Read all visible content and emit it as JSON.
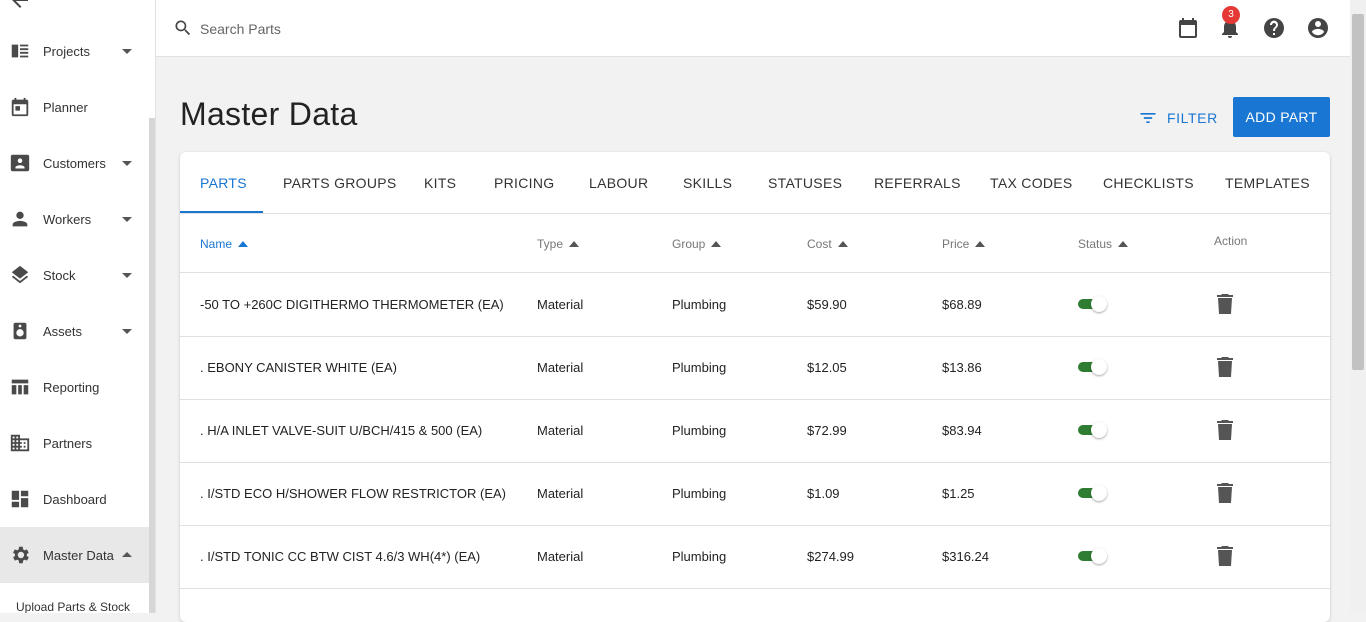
{
  "colors": {
    "accent": "#1976d2",
    "toggle_on": "#2e7d32",
    "badge": "#e53935"
  },
  "sidebar": {
    "items": [
      {
        "label": "Projects",
        "icon": "projects-icon",
        "has_caret": true
      },
      {
        "label": "Planner",
        "icon": "calendar-icon",
        "has_caret": false
      },
      {
        "label": "Customers",
        "icon": "contact-card-icon",
        "has_caret": true
      },
      {
        "label": "Workers",
        "icon": "person-icon",
        "has_caret": true
      },
      {
        "label": "Stock",
        "icon": "layers-icon",
        "has_caret": true
      },
      {
        "label": "Assets",
        "icon": "assets-icon",
        "has_caret": true
      },
      {
        "label": "Reporting",
        "icon": "table-icon",
        "has_caret": false
      },
      {
        "label": "Partners",
        "icon": "building-icon",
        "has_caret": false
      },
      {
        "label": "Dashboard",
        "icon": "dashboard-icon",
        "has_caret": false
      },
      {
        "label": "Master Data",
        "icon": "gear-icon",
        "has_caret": true,
        "expanded": true,
        "active": true
      }
    ],
    "subitem": "Upload Parts & Stock"
  },
  "topbar": {
    "search_placeholder": "Search Parts",
    "notification_count": "3"
  },
  "page": {
    "title": "Master Data",
    "filter_label": "FILTER",
    "add_label": "ADD PART"
  },
  "tabs": [
    "PARTS",
    "PARTS GROUPS",
    "KITS",
    "PRICING",
    "LABOUR",
    "SKILLS",
    "STATUSES",
    "REFERRALS",
    "TAX CODES",
    "CHECKLISTS",
    "TEMPLATES"
  ],
  "active_tab": "PARTS",
  "table": {
    "columns": [
      "Name",
      "Type",
      "Group",
      "Cost",
      "Price",
      "Status",
      "Action"
    ],
    "sorted_column": "Name",
    "rows": [
      {
        "name": "-50 TO +260C DIGITHERMO THERMOMETER (EA)",
        "type": "Material",
        "group": "Plumbing",
        "cost": "$59.90",
        "price": "$68.89",
        "active": true
      },
      {
        "name": ". EBONY CANISTER WHITE (EA)",
        "type": "Material",
        "group": "Plumbing",
        "cost": "$12.05",
        "price": "$13.86",
        "active": true
      },
      {
        "name": ". H/A INLET VALVE-SUIT U/BCH/415 & 500 (EA)",
        "type": "Material",
        "group": "Plumbing",
        "cost": "$72.99",
        "price": "$83.94",
        "active": true
      },
      {
        "name": ". I/STD ECO H/SHOWER FLOW RESTRICTOR (EA)",
        "type": "Material",
        "group": "Plumbing",
        "cost": "$1.09",
        "price": "$1.25",
        "active": true
      },
      {
        "name": ". I/STD TONIC CC BTW CIST 4.6/3 WH(4*) (EA)",
        "type": "Material",
        "group": "Plumbing",
        "cost": "$274.99",
        "price": "$316.24",
        "active": true
      }
    ]
  }
}
